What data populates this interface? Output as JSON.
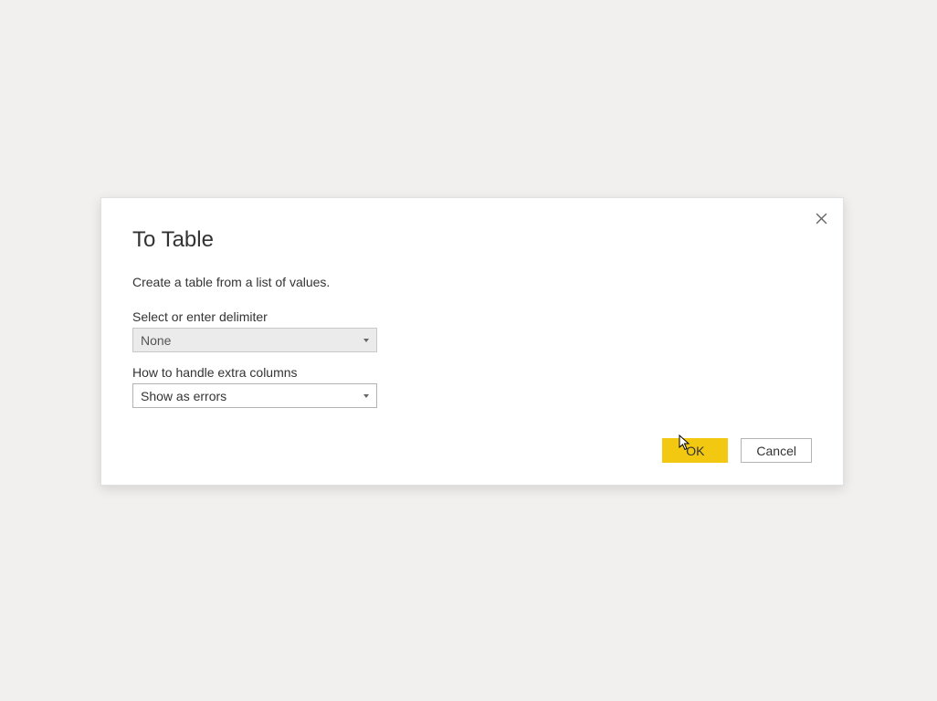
{
  "dialog": {
    "title": "To Table",
    "subtitle": "Create a table from a list of values.",
    "fields": {
      "delimiter": {
        "label": "Select or enter delimiter",
        "value": "None"
      },
      "extraColumns": {
        "label": "How to handle extra columns",
        "value": "Show as errors"
      }
    },
    "buttons": {
      "ok": "OK",
      "cancel": "Cancel"
    }
  }
}
